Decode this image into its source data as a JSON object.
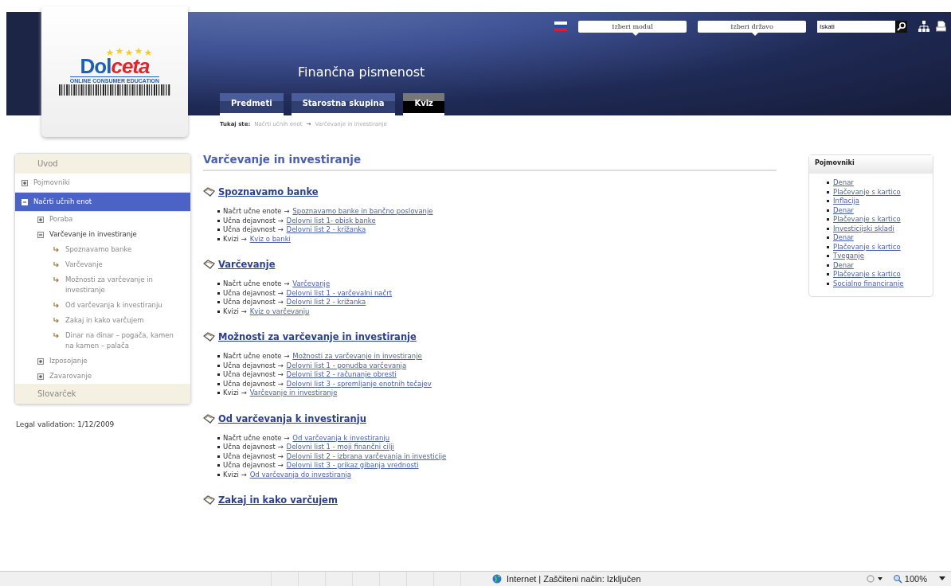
{
  "logo": {
    "word_start": "Dol",
    "word_end": "ceta",
    "tagline": "ONLINE CONSUMER EDUCATION"
  },
  "header": {
    "title": "Finančna pismenost",
    "module_select": "Izberi modul",
    "country_select": "Izberi državo",
    "search": {
      "value": "Iskati"
    }
  },
  "tabs": [
    {
      "label": "Predmeti",
      "selected": false
    },
    {
      "label": "Starostna skupina",
      "selected": false
    },
    {
      "label": "Kviz",
      "selected": true
    }
  ],
  "breadcrumb": {
    "label": "Tukaj ste:",
    "separator": "→",
    "crumbs": [
      "Načrti učnih enot",
      "Varčevanje in investiranje"
    ]
  },
  "sidebar": {
    "items": [
      {
        "kind": "section",
        "label": "Uvod"
      },
      {
        "kind": "node",
        "label": "Pojmovniki",
        "expanded": false,
        "selected": false
      },
      {
        "kind": "node",
        "label": "Načrti učnih enot",
        "expanded": true,
        "selected": true,
        "children": [
          {
            "kind": "node",
            "label": "Poraba",
            "expanded": false,
            "selected": false
          },
          {
            "kind": "node",
            "label": "Varčevanje in investiranje",
            "expanded": true,
            "selected": true,
            "children": [
              {
                "kind": "leaf",
                "label": "Spoznavamo banke",
                "selected": false
              },
              {
                "kind": "leaf",
                "label": "Varčevanje",
                "selected": false
              },
              {
                "kind": "leaf",
                "label": "Možnosti za varčevanje in investiranje",
                "selected": false
              },
              {
                "kind": "leaf",
                "label": "Od varčevanja k investiranju",
                "selected": false
              },
              {
                "kind": "leaf",
                "label": "Zakaj in kako varčujem",
                "selected": false
              },
              {
                "kind": "leaf",
                "label": "Dinar na dinar – pogača, kamen na kamen – palača",
                "selected": false
              }
            ]
          },
          {
            "kind": "node",
            "label": "Izposojanje",
            "expanded": false,
            "selected": false
          },
          {
            "kind": "node",
            "label": "Zavarovanje",
            "expanded": false,
            "selected": false
          }
        ]
      },
      {
        "kind": "section",
        "label": "Slovarček"
      }
    ]
  },
  "legal": "Legal validation: 1/12/2009",
  "main": {
    "title": "Varčevanje in investiranje",
    "sections": [
      {
        "heading": "Spoznavamo banke",
        "items": [
          {
            "label": "Načrt učne enote →",
            "link": "Spoznavamo banke in bančno poslovanje"
          },
          {
            "label": "Učna dejavnost →",
            "link": "Delovni list 1- obisk banke"
          },
          {
            "label": "Učna dejavnost →",
            "link": "Delovni list 2 - križanka"
          },
          {
            "label": "Kvizi →",
            "link": "Kviz o banki"
          }
        ]
      },
      {
        "heading": "Varčevanje",
        "items": [
          {
            "label": "Načrt učne enote →",
            "link": "Varčevanje"
          },
          {
            "label": "Učna dejavnost →",
            "link": "Delovni list 1 - varčevalni načrt"
          },
          {
            "label": "Učna dejavnost →",
            "link": "Delovni list 2 - križanka"
          },
          {
            "label": "Kvizi →",
            "link": "Kviz o varčevanju"
          }
        ]
      },
      {
        "heading": "Možnosti za varčevanje in investiranje",
        "items": [
          {
            "label": "Načrt učne enote →",
            "link": "Možnosti za varčevanje in investiranje"
          },
          {
            "label": "Učna dejavnost →",
            "link": "Delovni list 1 - ponudba varčevanja"
          },
          {
            "label": "Učna dejavnost →",
            "link": "Delovni list 2 - računanje obresti"
          },
          {
            "label": "Učna dejavnost →",
            "link": "Delovni list 3 - spremljanje enotnih tečajev"
          },
          {
            "label": "Kvizi →",
            "link": "Varčevanje in investiranje"
          }
        ]
      },
      {
        "heading": "Od varčevanja k investiranju",
        "items": [
          {
            "label": "Načrt učne enote →",
            "link": "Od varčevanja k investiranju"
          },
          {
            "label": "Učna dejavnost →",
            "link": "Delovni list 1 - moji finančni cilji"
          },
          {
            "label": "Učna dejavnost →",
            "link": "Delovni list 2 - izbrana varčevanja in investicije"
          },
          {
            "label": "Učna dejavnost →",
            "link": "Delovni list 3 - prikaz gibanja vrednosti"
          },
          {
            "label": "Kvizi →",
            "link": "Od varčevanja do investiranja"
          }
        ]
      },
      {
        "heading": "Zakaj in kako varčujem"
      }
    ]
  },
  "glossary": {
    "title": "Pojmovniki",
    "items": [
      "Denar",
      "Plačevanje s kartico",
      "Inflacija",
      "Denar",
      "Plačevanje s kartico",
      "Investicijski skladi",
      "Denar",
      "Plačevanje s kartico",
      "Tveganje",
      "Denar",
      "Plačevanje s kartico",
      "Socialno financiranje"
    ]
  },
  "status_bar": {
    "text": "Internet | Zaščiteni način: Izključen",
    "zoom": "100%"
  }
}
